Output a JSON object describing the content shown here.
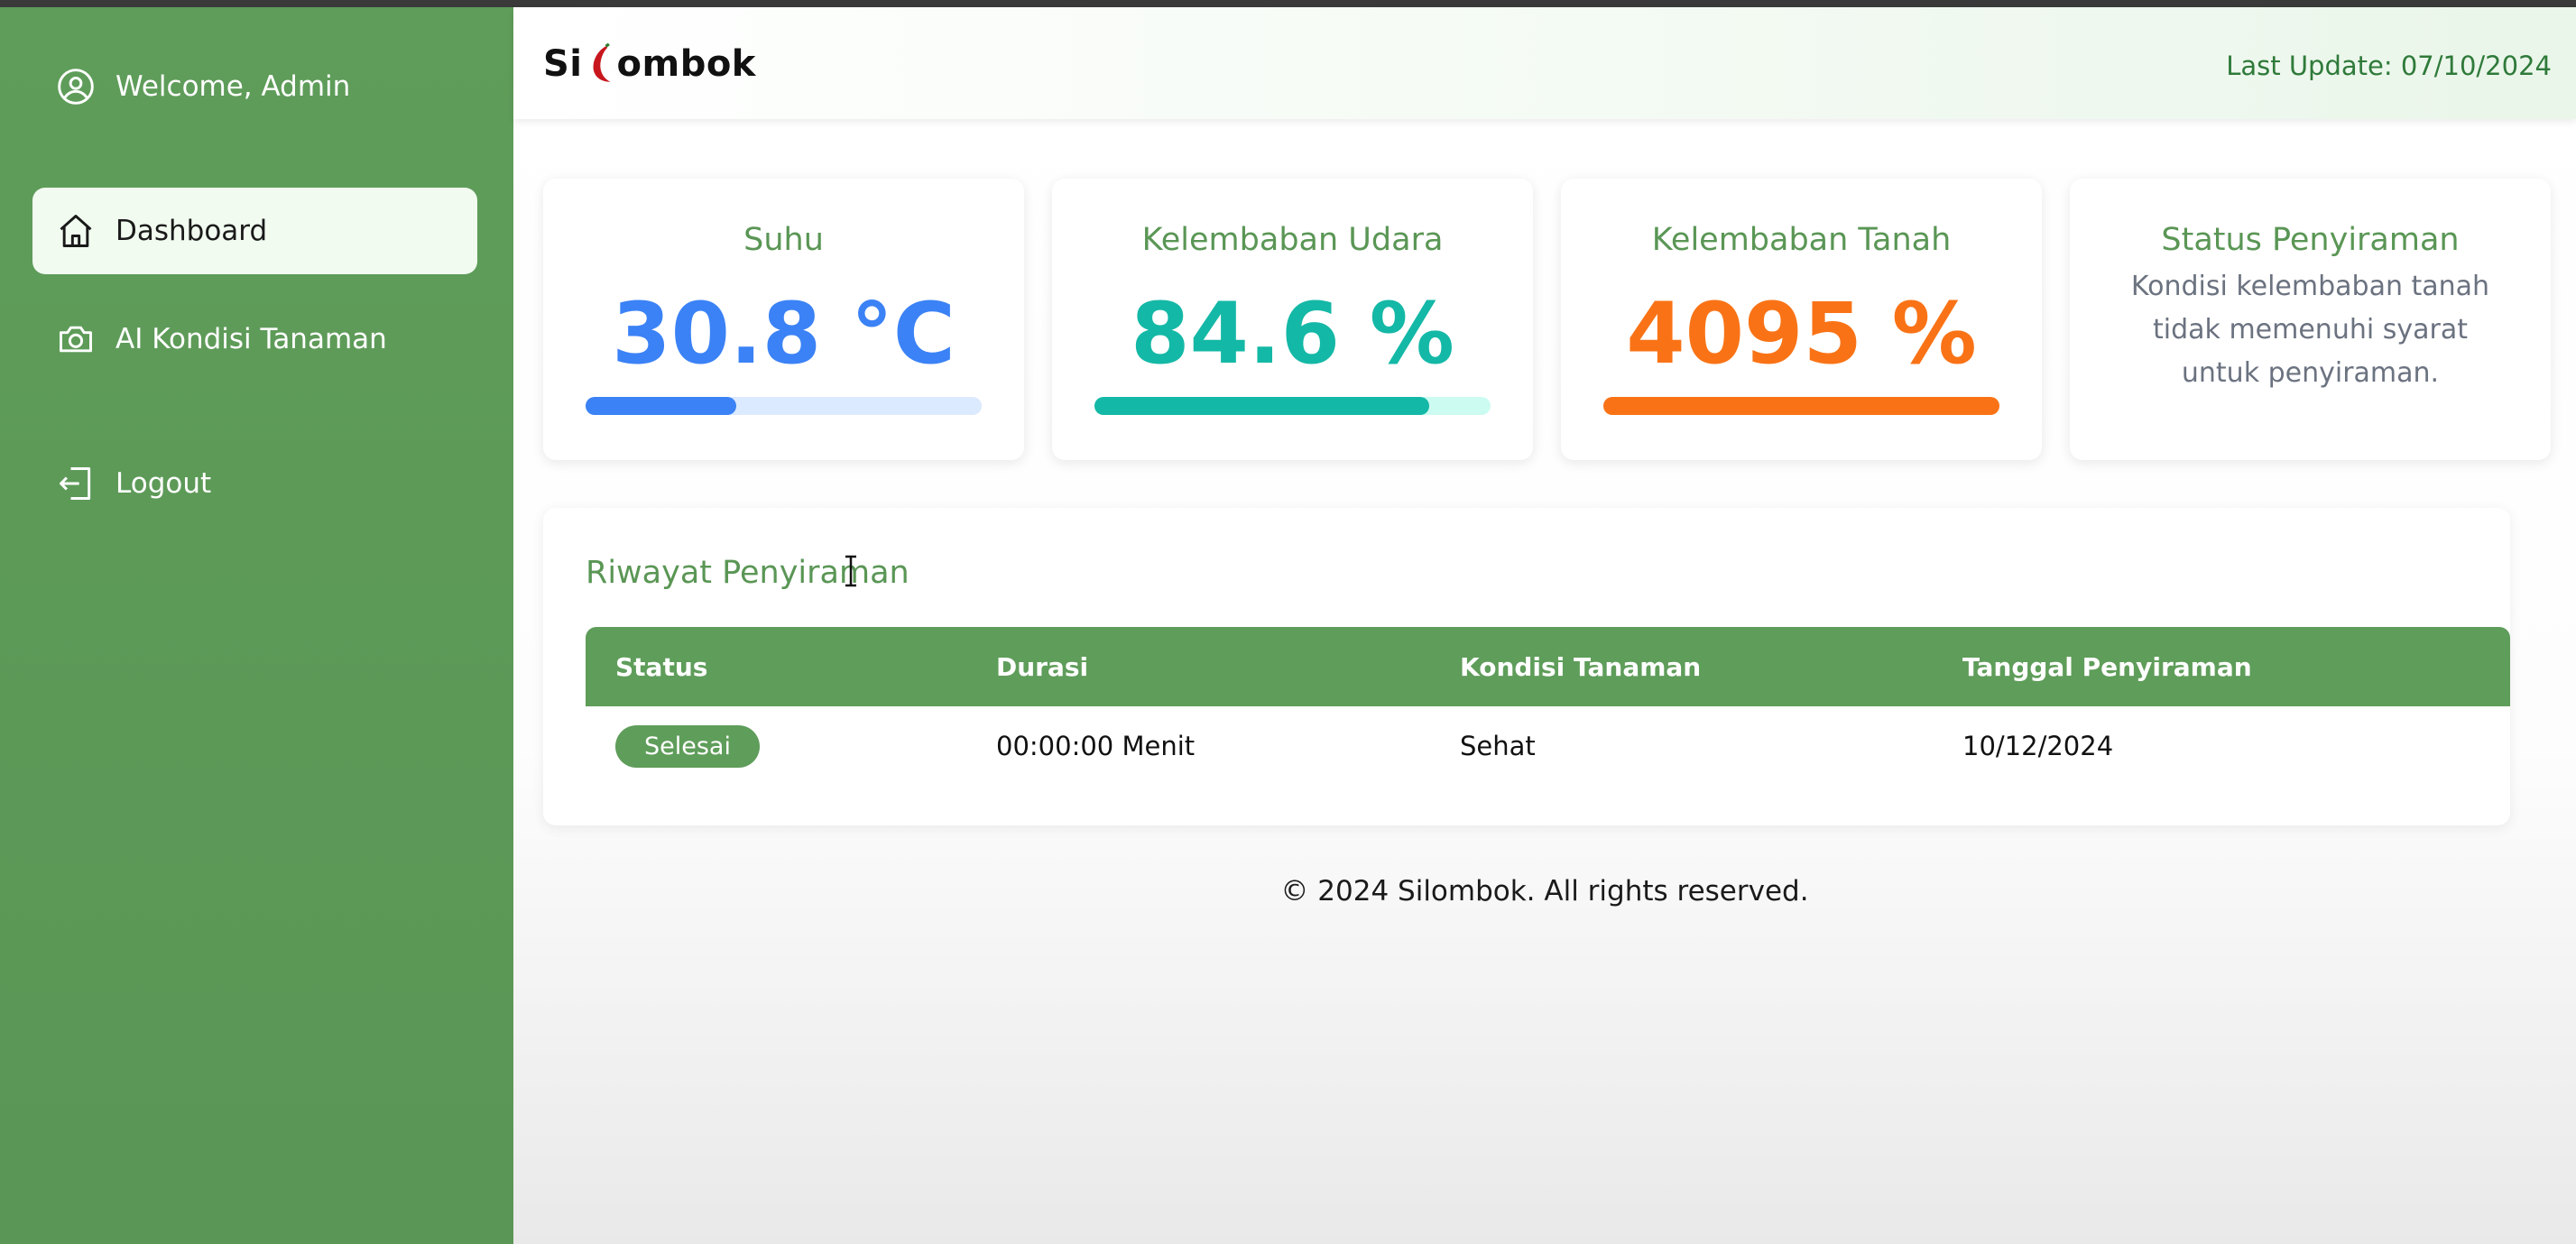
{
  "sidebar": {
    "welcome": "Welcome, Admin",
    "items": [
      {
        "label": "Dashboard",
        "icon": "home-icon",
        "active": true
      },
      {
        "label": "AI Kondisi Tanaman",
        "icon": "camera-icon"
      },
      {
        "label": "Logout",
        "icon": "logout-icon"
      }
    ]
  },
  "header": {
    "logo_left": "Si",
    "logo_right": "ombok",
    "last_update": "Last Update: 07/10/2024"
  },
  "cards": {
    "suhu": {
      "title": "Suhu",
      "value": "30.8 °C",
      "progress": 0.38,
      "color": "#3b82f6",
      "track": "#dbeafe"
    },
    "udara": {
      "title": "Kelembaban Udara",
      "value": "84.6 %",
      "progress": 0.846,
      "color": "#14b8a6",
      "track": "#ccfbf1"
    },
    "tanah": {
      "title": "Kelembaban Tanah",
      "value": "4095 %",
      "progress": 1.0,
      "color": "#f97316",
      "track": "#ffedd5"
    },
    "status": {
      "title": "Status Penyiraman",
      "text": "Kondisi kelembaban tanah tidak memenuhi syarat untuk penyiraman."
    }
  },
  "history": {
    "title": "Riwayat Penyiraman",
    "columns": [
      "Status",
      "Durasi",
      "Kondisi Tanaman",
      "Tanggal Penyiraman"
    ],
    "rows": [
      {
        "status": "Selesai",
        "durasi": "00:00:00 Menit",
        "kondisi": "Sehat",
        "tanggal": "10/12/2024"
      }
    ]
  },
  "footer": "© 2024 Silombok. All rights reserved.",
  "colors": {
    "primary": "#5f9d5a",
    "accent_text": "#2f7a3a"
  }
}
